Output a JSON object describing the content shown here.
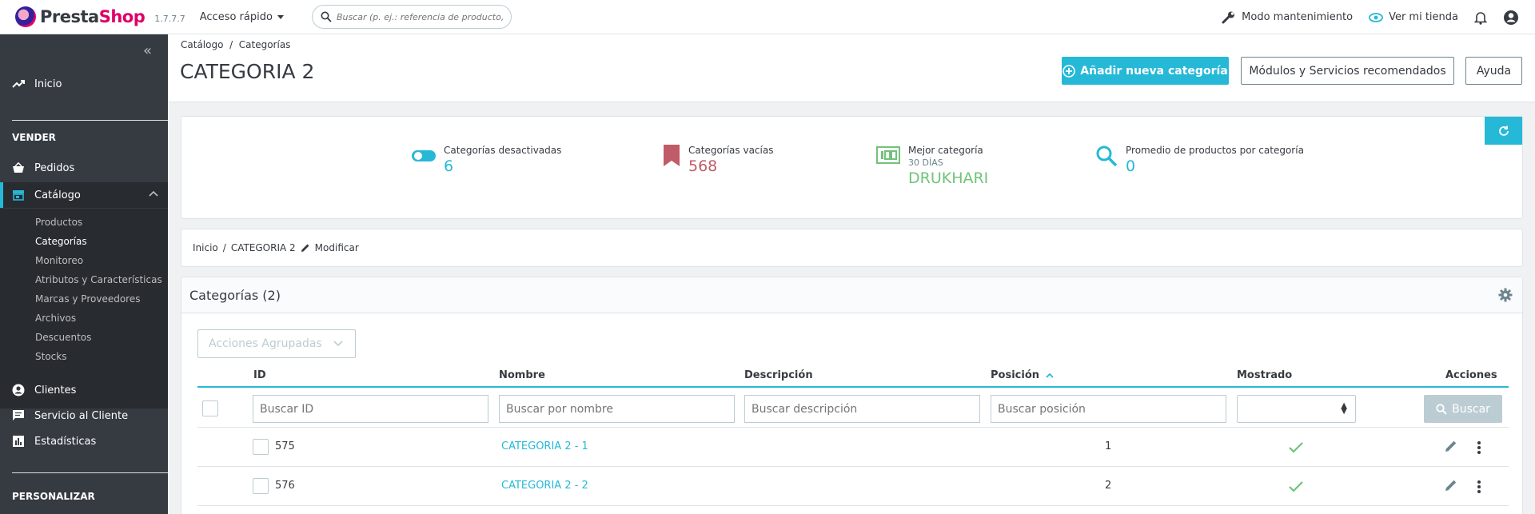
{
  "header": {
    "logo_text_a": "Presta",
    "logo_text_b": "Shop",
    "version": "1.7.7.7",
    "quick_access": "Acceso rápido",
    "search_placeholder": "Buscar (p. ej.: referencia de producto, n",
    "maintenance": "Modo mantenimiento",
    "view_store": "Ver mi tienda"
  },
  "sidebar": {
    "collapse": "«",
    "home": "Inicio",
    "section_sell": "VENDER",
    "orders": "Pedidos",
    "catalog": "Catálogo",
    "catalog_sub": [
      "Productos",
      "Categorías",
      "Monitoreo",
      "Atributos y Características",
      "Marcas y Proveedores",
      "Archivos",
      "Descuentos",
      "Stocks"
    ],
    "customers": "Clientes",
    "customer_service": "Servicio al Cliente",
    "stats": "Estadísticas",
    "section_customize": "PERSONALIZAR"
  },
  "page": {
    "breadcrumb_1": "Catálogo",
    "breadcrumb_2": "Categorías",
    "title": "CATEGORIA 2",
    "add_button": "Añadir nueva categoría",
    "modules_button": "Módulos y Servicios recomendados",
    "help_button": "Ayuda"
  },
  "kpis": {
    "disabled_label": "Categorías desactivadas",
    "disabled_value": "6",
    "empty_label": "Categorías vacías",
    "empty_value": "568",
    "best_label": "Mejor categoría",
    "best_sub": "30 DÍAS",
    "best_value": "DRUKHARI",
    "avg_label": "Promedio de productos por categoría",
    "avg_value": "0",
    "colors": {
      "blue": "#25b9d7",
      "red": "#c05c67",
      "green": "#72c279"
    }
  },
  "crumbs": {
    "home": "Inicio",
    "current": "CATEGORIA 2",
    "edit": "Modificar"
  },
  "table": {
    "title": "Categorías (2)",
    "bulk_actions": "Acciones Agrupadas",
    "columns": {
      "id": "ID",
      "name": "Nombre",
      "description": "Descripción",
      "position": "Posición",
      "displayed": "Mostrado",
      "actions": "Acciones"
    },
    "filters": {
      "id": "Buscar ID",
      "name": "Buscar por nombre",
      "description": "Buscar descripción",
      "position": "Buscar posición",
      "search_button": "Buscar"
    },
    "rows": [
      {
        "id": "575",
        "name": "CATEGORIA 2 - 1",
        "position": "1"
      },
      {
        "id": "576",
        "name": "CATEGORIA 2 - 2",
        "position": "2"
      }
    ]
  }
}
